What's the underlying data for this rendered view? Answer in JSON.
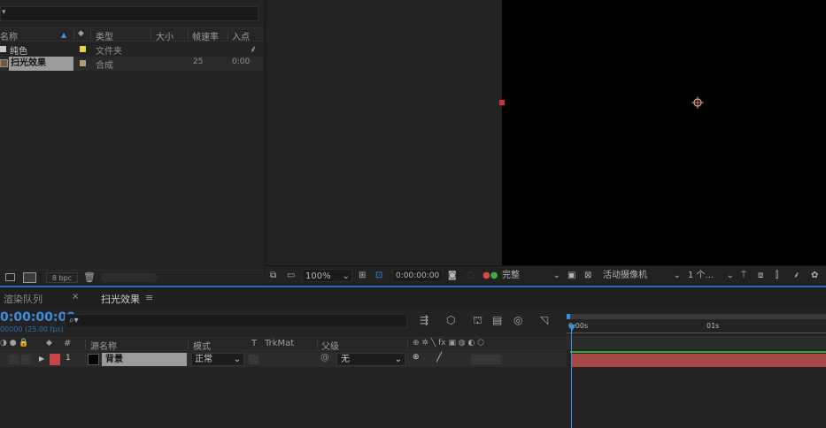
{
  "project": {
    "search_placeholder": "",
    "columns": {
      "name": "名称",
      "type": "类型",
      "size": "大小",
      "fps": "帧速率",
      "in": "入点"
    },
    "items": [
      {
        "name": "纯色",
        "type": "文件夹",
        "type_color": "#e6d24a",
        "fps": "",
        "in": ""
      },
      {
        "name": "扫光效果",
        "type": "合成",
        "type_color": "#b59b79",
        "fps": "25",
        "in": "0:00"
      }
    ],
    "footer": {
      "bpc": "8 bpc"
    }
  },
  "viewer": {
    "zoom": "100%",
    "timecode": "0:00:00:00",
    "resolution": "完整",
    "camera": "活动摄像机",
    "views": "1 个..."
  },
  "tabs": [
    {
      "label": "渲染队列"
    },
    {
      "label": "扫光效果"
    }
  ],
  "timeline": {
    "timecode": "0:00:00:00",
    "fps_label": "00000 (25.00 fps)",
    "search_placeholder": "",
    "columns": {
      "src": "源名称",
      "mode": "模式",
      "t": "T",
      "trkmat": "TrkMat",
      "parent": "父级",
      "num": "#"
    },
    "ruler": {
      "t0": "0:00s",
      "t1": "01s"
    },
    "layers": [
      {
        "num": "1",
        "name": "背景",
        "mode": "正常",
        "parent": "无",
        "label_color": "#c64545"
      }
    ]
  },
  "colors": {
    "accent": "#1e6fc4",
    "layer_bar": "#a84848",
    "green_bar": "#3aa53a"
  }
}
